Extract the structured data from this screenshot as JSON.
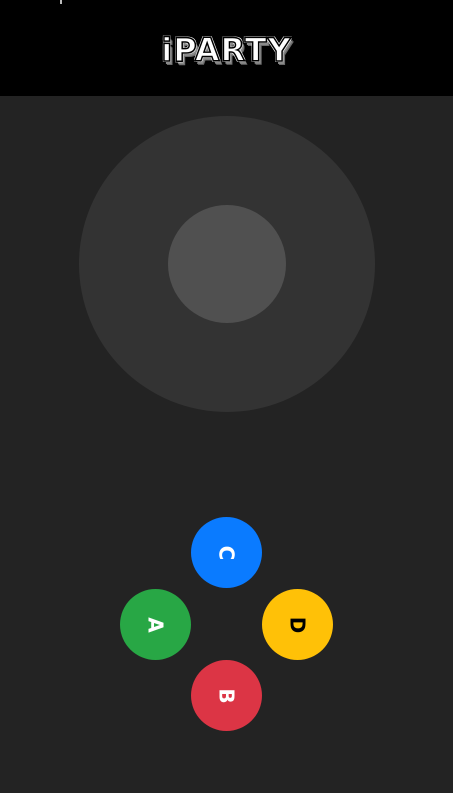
{
  "header": {
    "logo_text": "iPARTY",
    "background": "#000000"
  },
  "joystick": {
    "base_color": "#333333",
    "knob_color": "#505050"
  },
  "buttons": {
    "c": {
      "label": "C",
      "color": "#0a7bff",
      "text_color": "#ffffff"
    },
    "a": {
      "label": "A",
      "color": "#28a745",
      "text_color": "#ffffff"
    },
    "d": {
      "label": "D",
      "color": "#ffc107",
      "text_color": "#000000"
    },
    "b": {
      "label": "B",
      "color": "#dc3545",
      "text_color": "#ffffff"
    }
  },
  "colors": {
    "background": "#232323"
  }
}
